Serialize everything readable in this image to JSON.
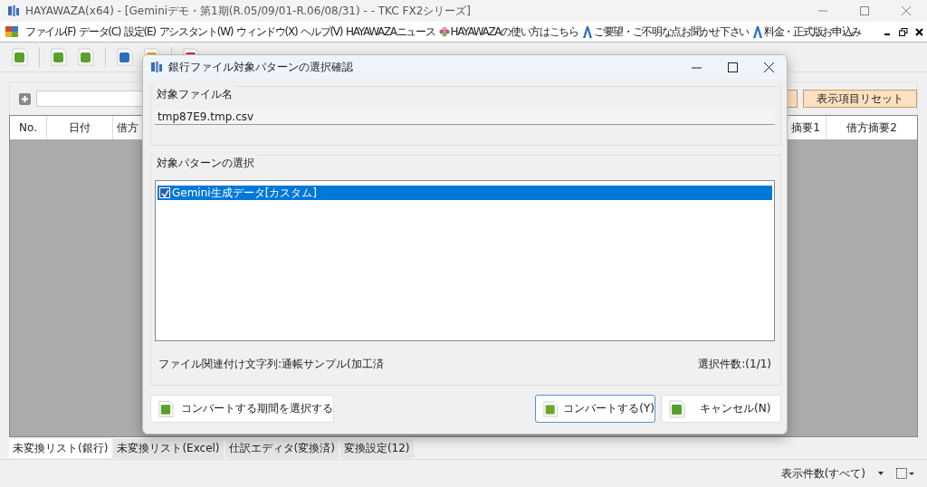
{
  "window": {
    "title": "HAYAWAZA(x64) - [Geminiデモ・第1期(R.05/09/01-R.06/08/31) -  - TKC FX2シリーズ]"
  },
  "menu": [
    {
      "label": "ファイル(F)",
      "kind": "menu"
    },
    {
      "label": "データ(C)",
      "kind": "menu"
    },
    {
      "label": "設定(E)",
      "kind": "menu"
    },
    {
      "label": "アシスタント(W)",
      "kind": "menu"
    },
    {
      "label": "ウィンドウ(X)",
      "kind": "menu"
    },
    {
      "label": "ヘルプ(V)",
      "kind": "menu"
    },
    {
      "label": "HAYAWAZAニュース",
      "kind": "menu"
    },
    {
      "label": "HAYAWAZAの使い方はこちら",
      "kind": "flower"
    },
    {
      "label": "ご要望・ご不明な点お聞かせ下さい",
      "kind": "letter"
    },
    {
      "label": "料金・正式版お申込み",
      "kind": "letter"
    }
  ],
  "filter": {
    "reset_button": "表示項目リセット"
  },
  "table": {
    "columns": [
      "No.",
      "日付",
      "借方",
      "摘要1",
      "借方摘要2"
    ]
  },
  "bottom_tabs": [
    {
      "label": "未変換リスト(銀行)",
      "selected": true
    },
    {
      "label": "未変換リスト(Excel)",
      "selected": false
    },
    {
      "label": "仕訳エディタ(変換済)",
      "selected": false
    },
    {
      "label": "変換設定(12)",
      "selected": false
    }
  ],
  "status_bar": {
    "count_label": "表示件数(すべて)"
  },
  "dialog": {
    "title": "銀行ファイル対象パターンの選択確認",
    "file_group": {
      "legend": "対象ファイル名",
      "value": "tmp87E9.tmp.csv"
    },
    "pattern_group": {
      "legend": "対象パターンの選択",
      "items": [
        {
          "label": "Gemini生成データ[カスタム]",
          "checked": true,
          "selected": true
        }
      ]
    },
    "association_text": "ファイル関連付け文字列:通帳サンプル(加工済",
    "selection_count": "選択件数:(1/1)",
    "buttons": [
      {
        "label": "コンバートする期間を選択する",
        "kind": "period",
        "focused": false
      },
      {
        "label": "コンバートする(Y)",
        "kind": "convert",
        "focused": true
      },
      {
        "label": "キャンセル(N)",
        "kind": "cancel",
        "focused": false
      }
    ]
  }
}
